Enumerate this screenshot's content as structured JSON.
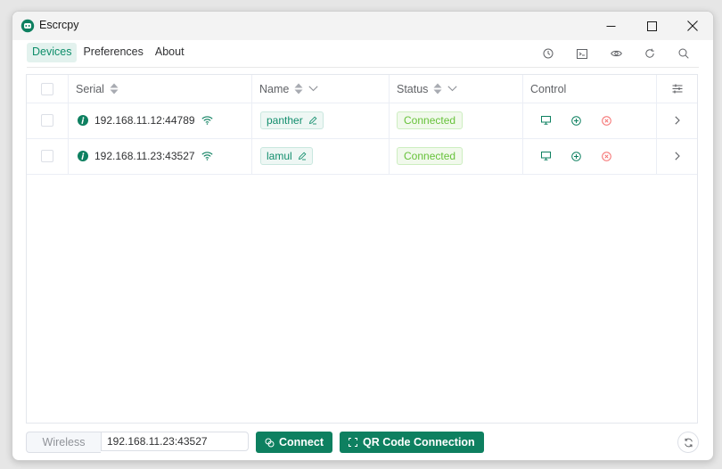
{
  "window": {
    "title": "Escrcpy"
  },
  "colors": {
    "accent": "#0e8060",
    "connected": "#67c23a",
    "danger": "#f56c6c"
  },
  "menu": {
    "items": [
      "Devices",
      "Preferences",
      "About"
    ],
    "active": "Devices"
  },
  "toolbar": {
    "icons": [
      "history-icon",
      "terminal-icon",
      "eye-icon",
      "refresh-icon",
      "search-icon"
    ]
  },
  "table": {
    "columns": {
      "serial": "Serial",
      "name": "Name",
      "status": "Status",
      "control": "Control"
    },
    "rows": [
      {
        "serial": "192.168.11.12:44789",
        "name": "panther",
        "status": "Connected"
      },
      {
        "serial": "192.168.11.23:43527",
        "name": "lamul",
        "status": "Connected"
      }
    ]
  },
  "bottom": {
    "wireless_label": "Wireless",
    "address_value": "192.168.11.23:43527",
    "connect_label": "Connect",
    "qr_label": "QR Code Connection"
  }
}
